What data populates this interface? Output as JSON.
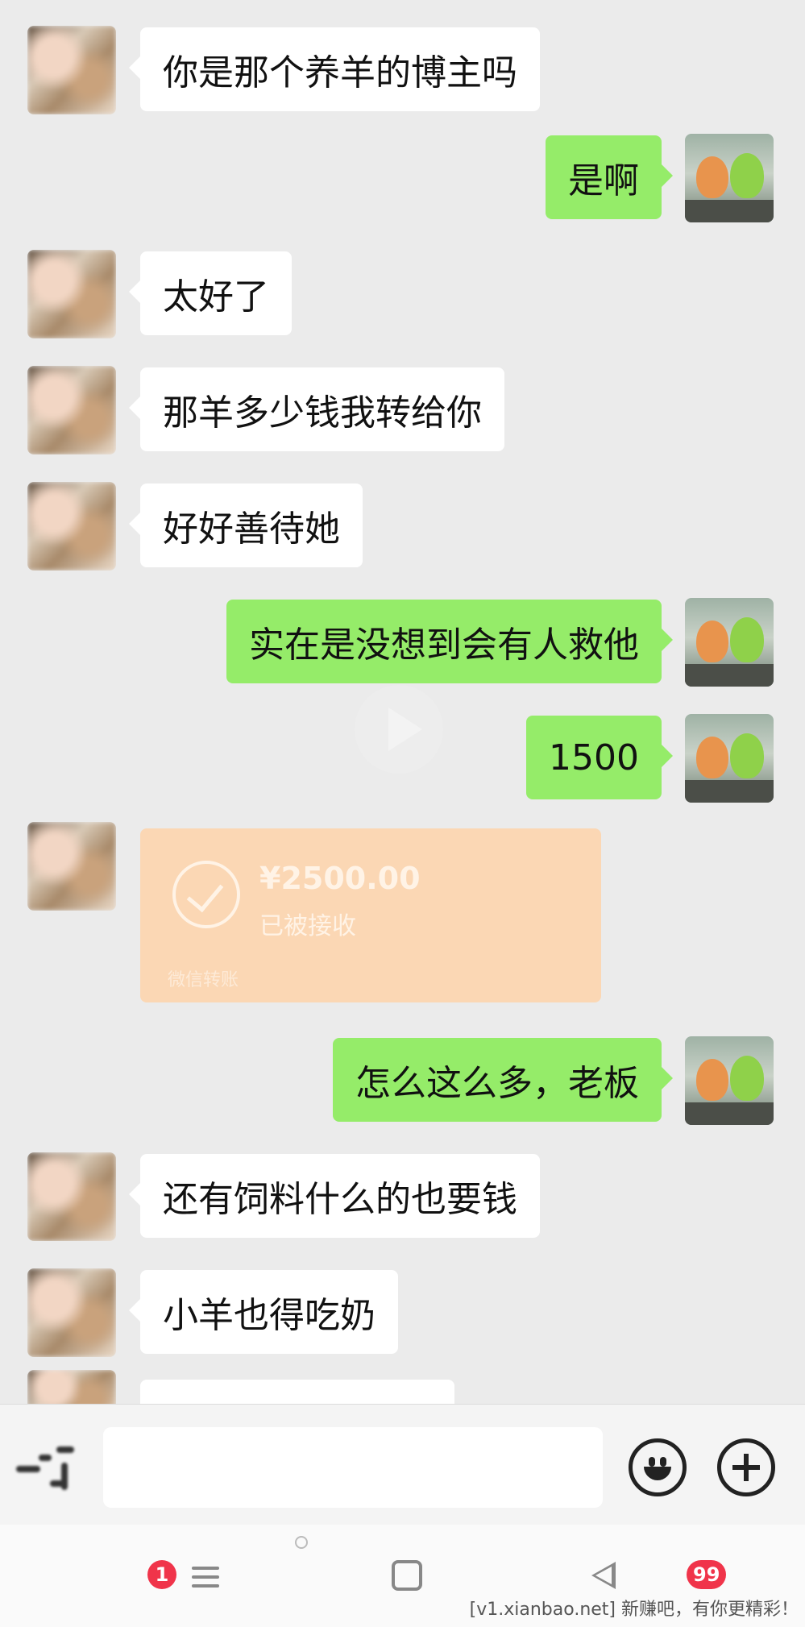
{
  "messages": [
    {
      "side": "left",
      "text": "你是那个养羊的博主吗"
    },
    {
      "side": "right",
      "text": "是啊"
    },
    {
      "side": "left",
      "text": "太好了"
    },
    {
      "side": "left",
      "text": "那羊多少钱我转给你"
    },
    {
      "side": "left",
      "text": "好好善待她"
    },
    {
      "side": "right",
      "text": "实在是没想到会有人救他"
    },
    {
      "side": "right",
      "text": "1500"
    },
    {
      "side": "left",
      "type": "transfer",
      "amount": "¥2500.00",
      "status": "已被接收",
      "footer": "微信转账"
    },
    {
      "side": "right",
      "text": "怎么这么多，老板"
    },
    {
      "side": "left",
      "text": "还有饲料什么的也要钱"
    },
    {
      "side": "left",
      "text": "小羊也得吃奶"
    }
  ],
  "input_bar": {
    "placeholder": "",
    "icons": [
      "voice-icon",
      "emoji-icon",
      "plus-icon"
    ]
  },
  "nav_bar": {
    "left_badge": "1",
    "right_badge": "99",
    "icons": [
      "menu-icon",
      "home-icon",
      "back-icon"
    ]
  },
  "colors": {
    "chat_bg": "#ebebeb",
    "sent_bubble": "#95ec69",
    "received_bubble": "#ffffff",
    "transfer_card": "#fbd7b4",
    "badge": "#f0344a"
  },
  "watermark": "[v1.xianbao.net] 新赚吧，有你更精彩！"
}
